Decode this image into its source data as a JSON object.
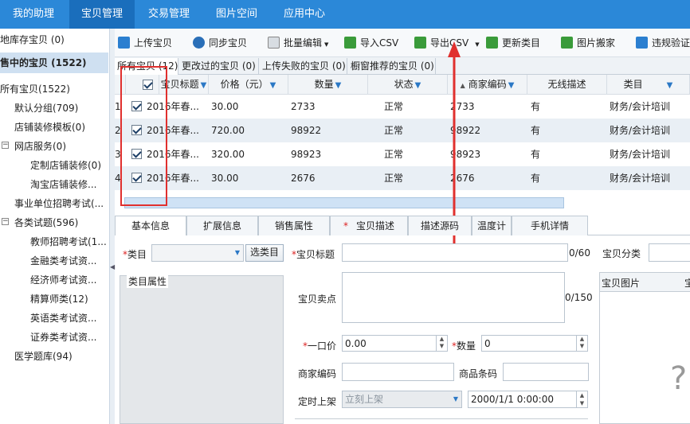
{
  "topnav": {
    "tabs": [
      {
        "label": "我的助理"
      },
      {
        "label": "宝贝管理",
        "active": true
      },
      {
        "label": "交易管理"
      },
      {
        "label": "图片空间"
      },
      {
        "label": "应用中心"
      }
    ]
  },
  "sidebar": {
    "warehouse": "地库存宝贝 (0)",
    "selling": "售中的宝贝 (1522)",
    "all": "所有宝贝(1522)",
    "items": [
      {
        "label": "默认分组(709)"
      },
      {
        "label": "店铺装修模板(0)"
      },
      {
        "label": "网店服务(0)"
      },
      {
        "label": "定制店铺装修(0)"
      },
      {
        "label": "淘宝店铺装修..."
      },
      {
        "label": "事业单位招聘考试(..."
      },
      {
        "label": "各类试题(596)"
      },
      {
        "label": "教师招聘考试(1..."
      },
      {
        "label": "金融类考试资..."
      },
      {
        "label": "经济师考试资..."
      },
      {
        "label": "精算师类(12)"
      },
      {
        "label": "英语类考试资..."
      },
      {
        "label": "证券类考试资..."
      },
      {
        "label": "医学题库(94)"
      }
    ]
  },
  "toolbar": {
    "upload": "上传宝贝",
    "sync": "同步宝贝",
    "batch_edit": "批量编辑",
    "import_csv": "导入CSV",
    "export_csv": "导出CSV",
    "update_category": "更新类目",
    "move_images": "图片搬家",
    "violation": "违规验证"
  },
  "subtabs": [
    {
      "label": "所有宝贝 (12)",
      "active": true
    },
    {
      "label": "更改过的宝贝 (0)"
    },
    {
      "label": "上传失败的宝贝 (0)"
    },
    {
      "label": "橱窗推荐的宝贝 (0)"
    }
  ],
  "grid": {
    "columns": [
      "宝贝标题",
      "价格（元）",
      "数量",
      "状态",
      "商家编码",
      "无线描述",
      "类目"
    ],
    "rows": [
      {
        "num": "1",
        "title": "2016年春...",
        "price": "30.00",
        "qty": "2733",
        "status": "正常",
        "code": "2733",
        "wireless": "有",
        "category": "财务/会计培训"
      },
      {
        "num": "2",
        "title": "2016年春...",
        "price": "720.00",
        "qty": "98922",
        "status": "正常",
        "code": "98922",
        "wireless": "有",
        "category": "财务/会计培训"
      },
      {
        "num": "3",
        "title": "2016年春...",
        "price": "320.00",
        "qty": "98923",
        "status": "正常",
        "code": "98923",
        "wireless": "有",
        "category": "财务/会计培训"
      },
      {
        "num": "4",
        "title": "2016年春...",
        "price": "30.00",
        "qty": "2676",
        "status": "正常",
        "code": "2676",
        "wireless": "有",
        "category": "财务/会计培训"
      }
    ]
  },
  "bottom_tabs": [
    {
      "label": "基本信息",
      "active": true
    },
    {
      "label": "扩展信息"
    },
    {
      "label": "销售属性"
    },
    {
      "label": "宝贝描述",
      "required": true
    },
    {
      "label": "描述源码"
    },
    {
      "label": "温度计"
    },
    {
      "label": "手机详情"
    }
  ],
  "form": {
    "category_label": "类目",
    "select_category_btn": "选类目",
    "category_attrs": "类目属性",
    "title_label": "宝贝标题",
    "title_count": "0/60",
    "shop_category_label": "宝贝分类",
    "selling_points_label": "宝贝卖点",
    "selling_points_count": "0/150",
    "images_label": "宝贝图片",
    "images_col2": "宝",
    "price_label": "一口价",
    "price_value": "0.00",
    "qty_label": "数量",
    "qty_value": "0",
    "merchant_code_label": "商家编码",
    "barcode_label": "商品条码",
    "schedule_label": "定时上架",
    "schedule_value": "立刻上架",
    "schedule_date": "2000/1/1  0:00:00",
    "required_mark": "*"
  },
  "colors": {
    "accent": "#2b88d8",
    "annotation": "#e0302e"
  }
}
